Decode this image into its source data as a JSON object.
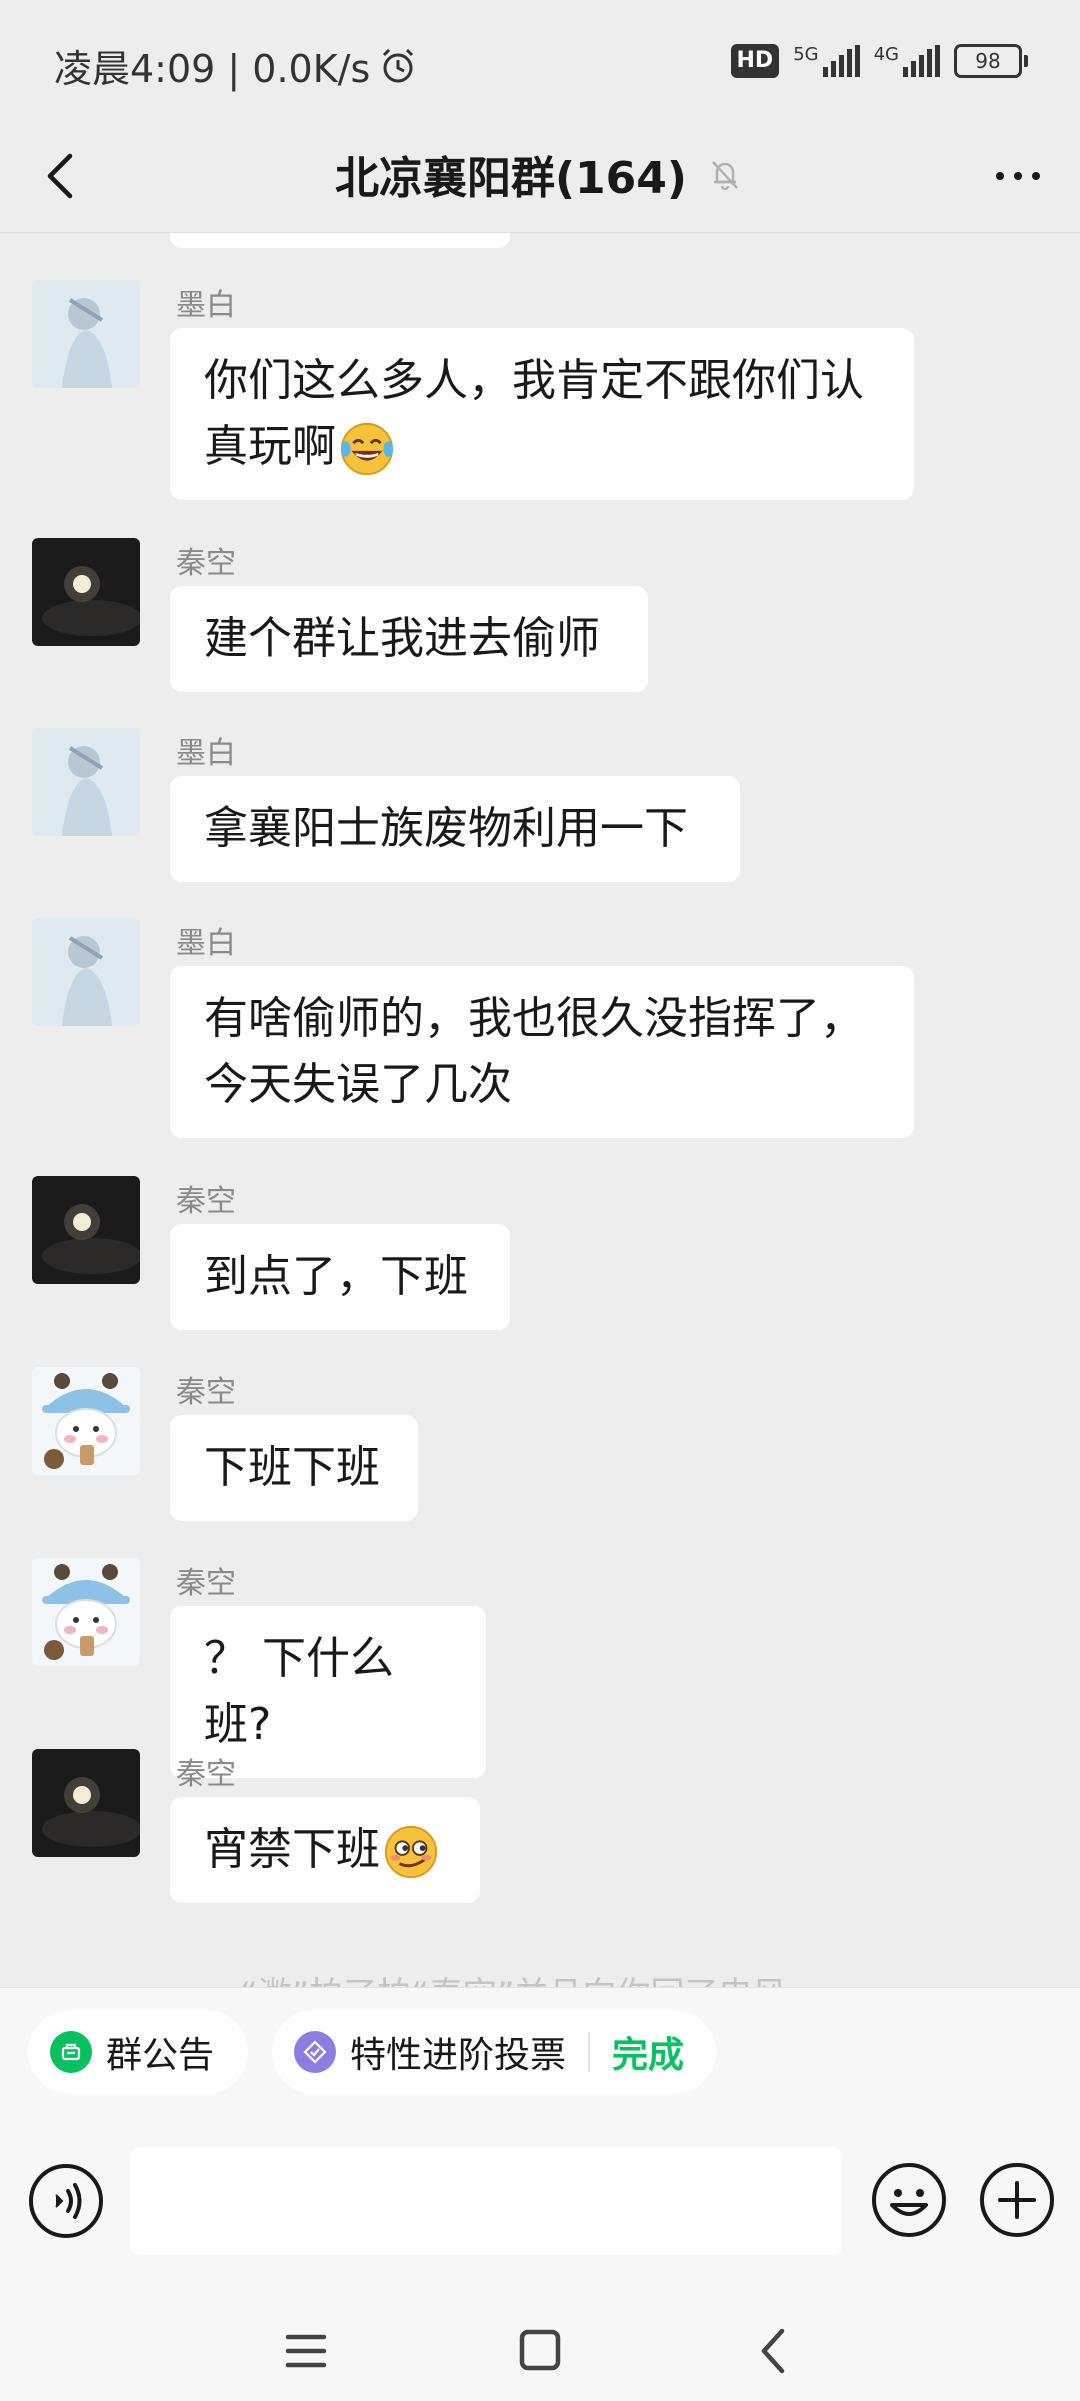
{
  "status": {
    "time": "凌晨4:09 | 0.0K/s",
    "hd": "HD",
    "net1": "5G",
    "net2": "4G",
    "battery": "98"
  },
  "header": {
    "title": "北凉襄阳群(164)"
  },
  "messages": [
    {
      "sender": "墨白",
      "text": "你们这么多人，我肯定不跟你们认真玩啊",
      "emoji": "laughing-tears"
    },
    {
      "sender": "秦空",
      "text": "建个群让我进去偷师"
    },
    {
      "sender": "墨白",
      "text": "拿襄阳士族废物利用一下"
    },
    {
      "sender": "墨白",
      "text": "有啥偷师的，我也很久没指挥了，今天失误了几次"
    },
    {
      "sender": "秦空",
      "text": "到点了，下班"
    },
    {
      "sender": "秦空",
      "text": "下班下班"
    },
    {
      "sender": "秦空",
      "text": "？ 下什么班?"
    },
    {
      "sender": "秦空",
      "text": "宵禁下班",
      "emoji": "smirk"
    }
  ],
  "hint": "“溦”拍了拍“秦空”并且向你回了电风",
  "chips": {
    "announcement": "群公告",
    "vote": "特性进阶投票",
    "done": "完成"
  },
  "input": {
    "placeholder": ""
  }
}
